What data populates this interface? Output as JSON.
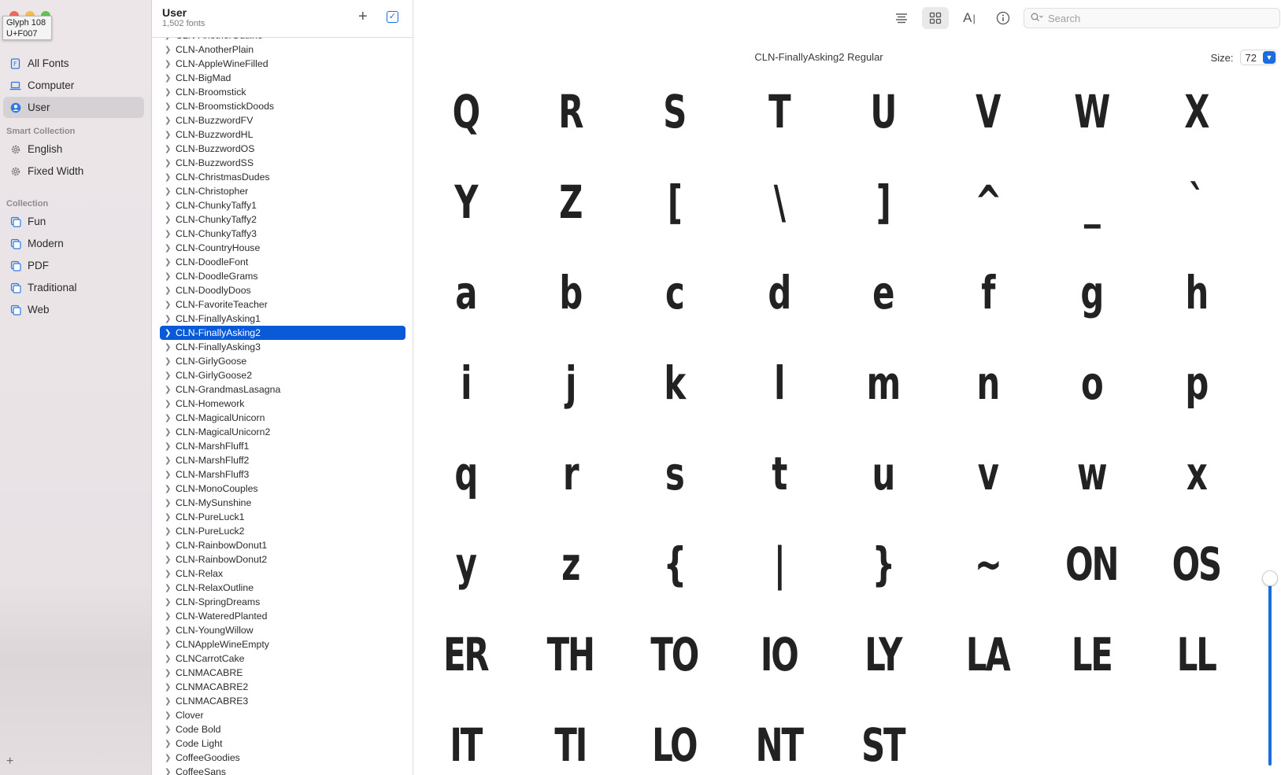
{
  "tooltip": {
    "line1": "Glyph 108",
    "line2": "U+F007"
  },
  "sidebar": {
    "library": [
      {
        "label": "All Fonts",
        "icon": "font-book-icon",
        "selected": false
      },
      {
        "label": "Computer",
        "icon": "laptop-icon",
        "selected": false
      },
      {
        "label": "User",
        "icon": "user-icon",
        "selected": true
      }
    ],
    "smart_header": "Smart Collection",
    "smart": [
      {
        "label": "English",
        "icon": "gear-icon"
      },
      {
        "label": "Fixed Width",
        "icon": "gear-icon"
      }
    ],
    "collection_header": "Collection",
    "collections": [
      {
        "label": "Fun",
        "icon": "collection-icon"
      },
      {
        "label": "Modern",
        "icon": "collection-icon"
      },
      {
        "label": "PDF",
        "icon": "collection-icon"
      },
      {
        "label": "Traditional",
        "icon": "collection-icon"
      },
      {
        "label": "Web",
        "icon": "collection-icon"
      }
    ],
    "add_label": "+"
  },
  "font_list": {
    "title": "User",
    "count": "1,502 fonts",
    "selected": "CLN-FinallyAsking2",
    "items": [
      "CLN-AnotherOutline",
      "CLN-AnotherPlain",
      "CLN-AppleWineFilled",
      "CLN-BigMad",
      "CLN-Broomstick",
      "CLN-BroomstickDoods",
      "CLN-BuzzwordFV",
      "CLN-BuzzwordHL",
      "CLN-BuzzwordOS",
      "CLN-BuzzwordSS",
      "CLN-ChristmasDudes",
      "CLN-Christopher",
      "CLN-ChunkyTaffy1",
      "CLN-ChunkyTaffy2",
      "CLN-ChunkyTaffy3",
      "CLN-CountryHouse",
      "CLN-DoodleFont",
      "CLN-DoodleGrams",
      "CLN-DoodlyDoos",
      "CLN-FavoriteTeacher",
      "CLN-FinallyAsking1",
      "CLN-FinallyAsking2",
      "CLN-FinallyAsking3",
      "CLN-GirlyGoose",
      "CLN-GirlyGoose2",
      "CLN-GrandmasLasagna",
      "CLN-Homework",
      "CLN-MagicalUnicorn",
      "CLN-MagicalUnicorn2",
      "CLN-MarshFluff1",
      "CLN-MarshFluff2",
      "CLN-MarshFluff3",
      "CLN-MonoCouples",
      "CLN-MySunshine",
      "CLN-PureLuck1",
      "CLN-PureLuck2",
      "CLN-RainbowDonut1",
      "CLN-RainbowDonut2",
      "CLN-Relax",
      "CLN-RelaxOutline",
      "CLN-SpringDreams",
      "CLN-WateredPlanted",
      "CLN-YoungWillow",
      "CLNAppleWineEmpty",
      "CLNCarrotCake",
      "CLNMACABRE",
      "CLNMACABRE2",
      "CLNMACABRE3",
      "Clover",
      "Code Bold",
      "Code Light",
      "CoffeeGoodies",
      "CoffeeSans"
    ]
  },
  "preview": {
    "font_name": "CLN-FinallyAsking2 Regular",
    "size_label": "Size:",
    "size_value": "72",
    "search_placeholder": "Search",
    "toolbar": [
      "sample-text-icon",
      "grid-view-icon",
      "type-size-icon",
      "info-icon"
    ],
    "glyphs": [
      "Q",
      "R",
      "S",
      "T",
      "U",
      "V",
      "W",
      "X",
      "Y",
      "Z",
      "[",
      "\\",
      "]",
      "^",
      "_",
      "`",
      "a",
      "b",
      "c",
      "d",
      "e",
      "f",
      "g",
      "h",
      "i",
      "j",
      "k",
      "l",
      "m",
      "n",
      "o",
      "p",
      "q",
      "r",
      "s",
      "t",
      "u",
      "v",
      "w",
      "x",
      "y",
      "z",
      "{",
      "|",
      "}",
      "~",
      "ON",
      "OS",
      "ER",
      "TH",
      "TO",
      "IO",
      "LY",
      "LA",
      "LE",
      "LL",
      "IT",
      "TI",
      "LO",
      "NT",
      "ST"
    ],
    "scroll_fraction": 0.73
  },
  "colors": {
    "accent": "#1a6ddf",
    "selection": "#0a5ad8",
    "sidebar_bg": "#ece6e9"
  }
}
